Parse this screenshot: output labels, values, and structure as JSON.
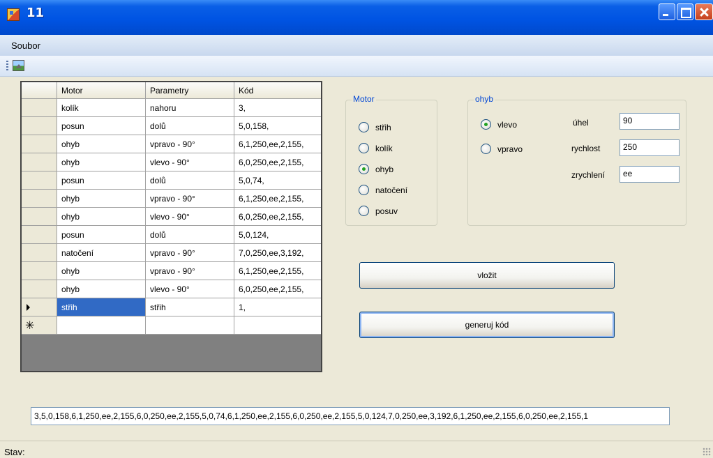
{
  "window": {
    "title": "11"
  },
  "menu": {
    "items": [
      "Soubor"
    ]
  },
  "grid": {
    "columns": [
      "Motor",
      "Parametry",
      "Kód"
    ],
    "rows": [
      [
        "kolík",
        "nahoru",
        "3,"
      ],
      [
        "posun",
        "dolů",
        "5,0,158,"
      ],
      [
        "ohyb",
        "vpravo - 90°",
        "6,1,250,ee,2,155,"
      ],
      [
        "ohyb",
        "vlevo - 90°",
        "6,0,250,ee,2,155,"
      ],
      [
        "posun",
        "dolů",
        "5,0,74,"
      ],
      [
        "ohyb",
        "vpravo - 90°",
        "6,1,250,ee,2,155,"
      ],
      [
        "ohyb",
        "vlevo - 90°",
        "6,0,250,ee,2,155,"
      ],
      [
        "posun",
        "dolů",
        "5,0,124,"
      ],
      [
        "natočení",
        "vpravo - 90°",
        "7,0,250,ee,3,192,"
      ],
      [
        "ohyb",
        "vpravo - 90°",
        "6,1,250,ee,2,155,"
      ],
      [
        "ohyb",
        "vlevo - 90°",
        "6,0,250,ee,2,155,"
      ],
      [
        "střih",
        "střih",
        "1,"
      ]
    ],
    "current_row_index": 11
  },
  "motor_group": {
    "title": "Motor",
    "options": [
      "střih",
      "kolík",
      "ohyb",
      "natočení",
      "posuv"
    ],
    "selected": "ohyb"
  },
  "ohyb_group": {
    "title": "ohyb",
    "options": [
      "vlevo",
      "vpravo"
    ],
    "selected": "vlevo",
    "fields": {
      "uhel": {
        "label": "úhel",
        "value": "90"
      },
      "rychlost": {
        "label": "rychlost",
        "value": "250"
      },
      "zrychleni": {
        "label": "zrychlení",
        "value": "ee"
      }
    }
  },
  "buttons": {
    "insert": "vložit",
    "generate": "generuj kód"
  },
  "output": {
    "code": "3,5,0,158,6,1,250,ee,2,155,6,0,250,ee,2,155,5,0,74,6,1,250,ee,2,155,6,0,250,ee,2,155,5,0,124,7,0,250,ee,3,192,6,1,250,ee,2,155,6,0,250,ee,2,155,1"
  },
  "status": {
    "label": "Stav:"
  },
  "icons": {
    "app": "app-icon",
    "toolbar": "image-icon",
    "current_row": "arrow-icon",
    "new_row": "asterisk-icon"
  }
}
